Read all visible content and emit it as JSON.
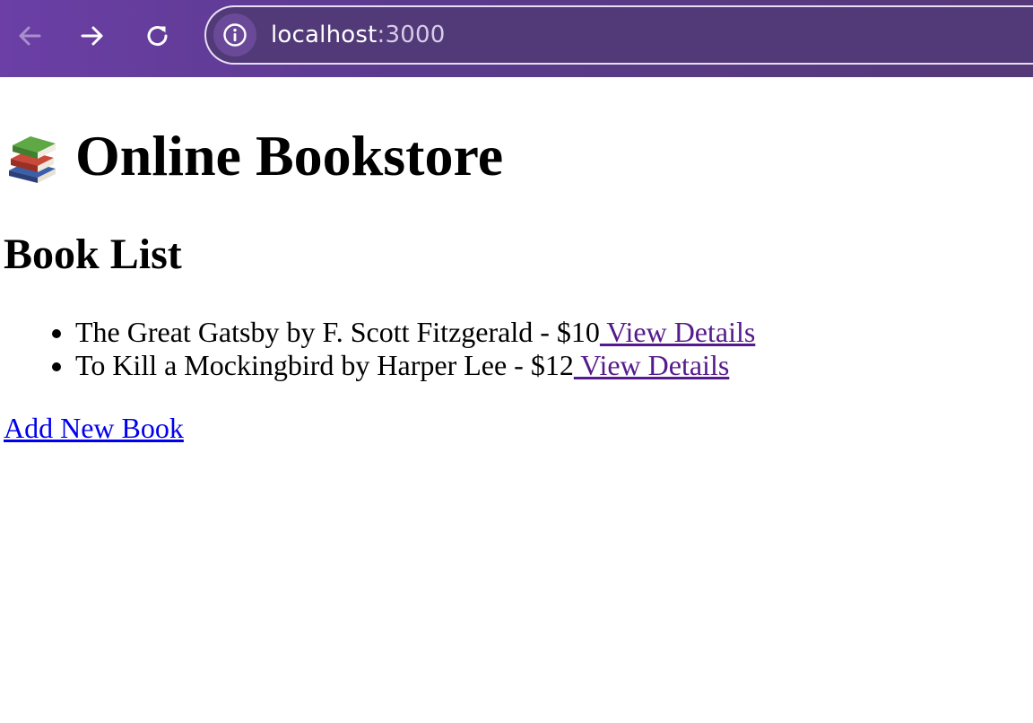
{
  "browser": {
    "url_host": "localhost",
    "url_port": ":3000"
  },
  "page": {
    "title": "Online Bookstore",
    "section_title": "Book List",
    "books": [
      {
        "text": "The Great Gatsby by F. Scott Fitzgerald - $10",
        "link": " View Details"
      },
      {
        "text": "To Kill a Mockingbird by Harper Lee - $12",
        "link": " View Details"
      }
    ],
    "add_link": "Add New Book"
  },
  "colors": {
    "toolbar": "#6b3fa6",
    "visited_link": "#551a8b",
    "unvisited_link": "#0000ee"
  },
  "icons": [
    "back-arrow-icon",
    "forward-arrow-icon",
    "reload-icon",
    "site-info-icon",
    "books-icon"
  ]
}
